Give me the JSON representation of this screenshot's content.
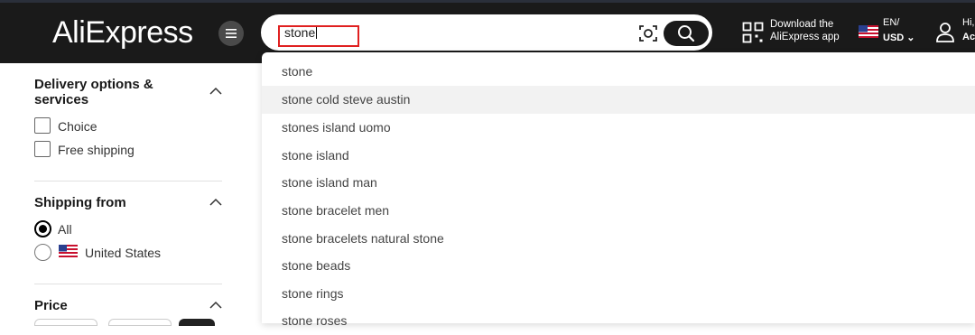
{
  "header": {
    "logo": "AliExpress",
    "search": {
      "value": "stone"
    },
    "app_line1": "Download the",
    "app_line2": "AliExpress app",
    "lang": "EN/",
    "currency": "USD",
    "hi": "Hi,",
    "account": "Ac"
  },
  "sidebar": {
    "delivery_title_1": "Delivery options &",
    "delivery_title_2": "services",
    "delivery_options": [
      "Choice",
      "Free shipping"
    ],
    "shipping_title": "Shipping from",
    "shipping_options": [
      "All",
      "United States"
    ],
    "price_title": "Price"
  },
  "suggestions": [
    "stone",
    "stone cold steve austin",
    "stones island uomo",
    "stone island",
    "stone island man",
    "stone bracelet men",
    "stone bracelets natural stone",
    "stone beads",
    "stone rings",
    "stone roses"
  ],
  "colors": {
    "topbar": "#1a1a1a",
    "highlight": "#e02020"
  }
}
